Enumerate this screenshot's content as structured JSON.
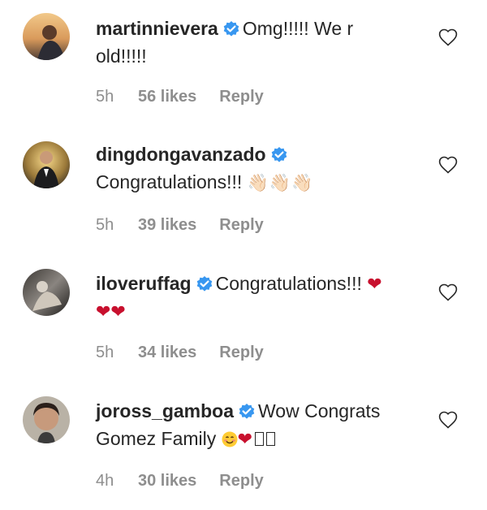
{
  "comments": [
    {
      "username": "martinnievera",
      "text_line1": "Omg!!!!! We r",
      "text_line2": "old!!!!!",
      "time": "5h",
      "likes": "56 likes",
      "reply": "Reply"
    },
    {
      "username": "dingdongavanzado",
      "text_line1": "Congratulations!!!",
      "emoji": "👋🏻👋🏻👋🏻",
      "time": "5h",
      "likes": "39 likes",
      "reply": "Reply"
    },
    {
      "username": "iloveruffag",
      "text_line1": "Congratulations!!!",
      "hearts_line1": "❤",
      "hearts_line2": "❤❤",
      "time": "5h",
      "likes": "34 likes",
      "reply": "Reply"
    },
    {
      "username": "joross_gamboa",
      "text_line1": "Wow Congrats",
      "text_line2": "Gomez Family",
      "heart": "❤",
      "time": "4h",
      "likes": "30 likes",
      "reply": "Reply"
    }
  ],
  "icons": {
    "verified_badge": "verified-badge-icon",
    "like": "heart-outline-icon"
  },
  "colors": {
    "verified": "#3897f0",
    "meta_text": "#8e8e8e",
    "heart": "#c8102e"
  }
}
